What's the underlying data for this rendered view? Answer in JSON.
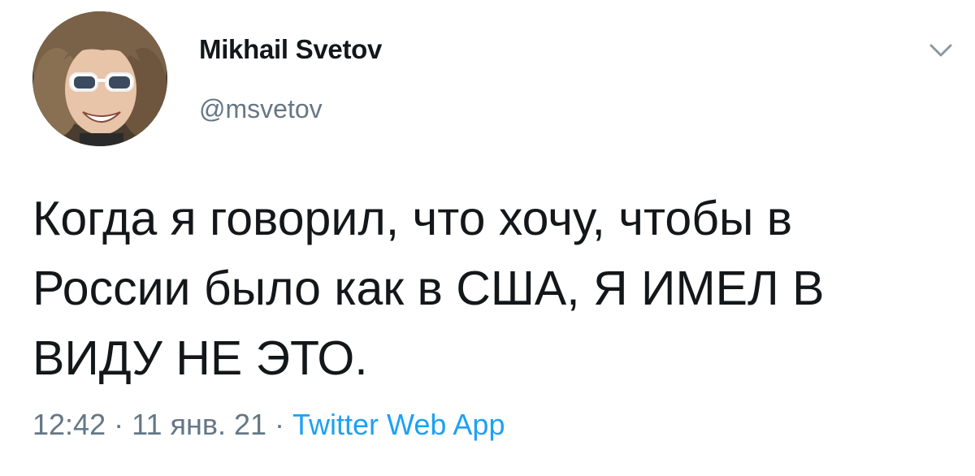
{
  "tweet": {
    "author": {
      "display_name": "Mikhail Svetov",
      "handle": "@msvetov",
      "avatar_icon": "user-avatar-photo"
    },
    "menu_icon": "chevron-down-icon",
    "text": "Когда я говорил, что хочу, чтобы в России было как в США, Я ИМЕЛ В ВИДУ НЕ ЭТО.",
    "meta": {
      "time": "12:42",
      "separator": "·",
      "date": "11 янв. 21",
      "source": "Twitter Web App"
    }
  },
  "colors": {
    "text": "#14171a",
    "secondary": "#657786",
    "link": "#1da1f2",
    "background": "#ffffff"
  }
}
